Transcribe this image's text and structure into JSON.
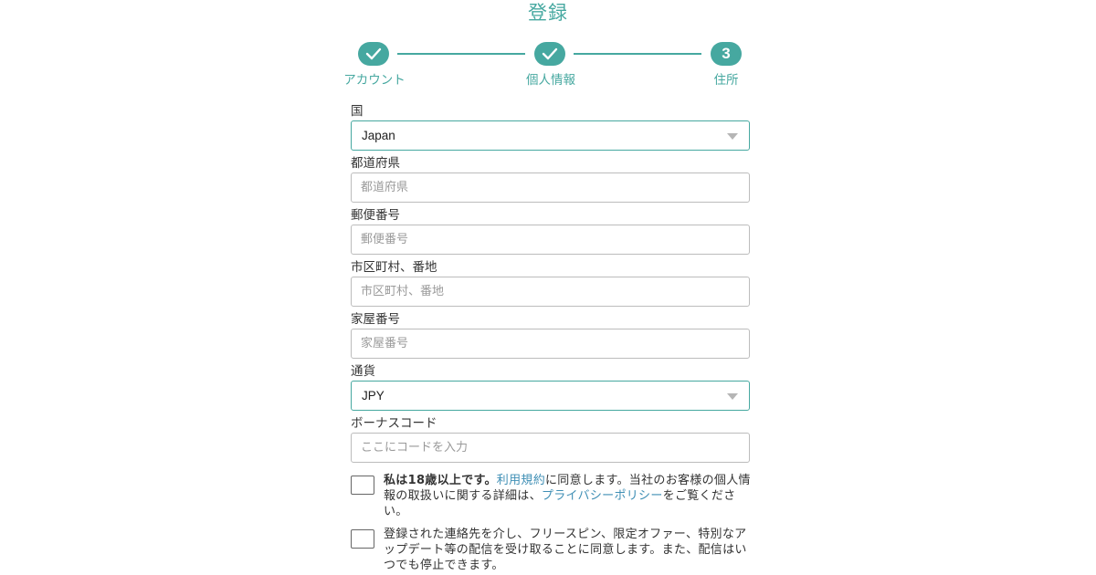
{
  "title": "登録",
  "colors": {
    "accent": "#46a8a0",
    "link": "#3f8fb5"
  },
  "steps": [
    {
      "label": "アカウント",
      "state": "done",
      "icon": "check-icon"
    },
    {
      "label": "個人情報",
      "state": "done",
      "icon": "check-icon"
    },
    {
      "label": "住所",
      "state": "current",
      "number": "3"
    }
  ],
  "form": {
    "country": {
      "label": "国",
      "value": "Japan"
    },
    "prefecture": {
      "label": "都道府県",
      "placeholder": "都道府県"
    },
    "postal": {
      "label": "郵便番号",
      "placeholder": "郵便番号"
    },
    "city": {
      "label": "市区町村、番地",
      "placeholder": "市区町村、番地"
    },
    "house": {
      "label": "家屋番号",
      "placeholder": "家屋番号"
    },
    "currency": {
      "label": "通貨",
      "value": "JPY"
    },
    "bonus": {
      "label": "ボーナスコード",
      "placeholder": "ここにコードを入力"
    }
  },
  "consent": {
    "age": {
      "bold": "私は18歳以上です。",
      "terms_link": "利用規約",
      "text1": "に同意します。当社のお客様の個人情報の取扱いに関する詳細は、",
      "privacy_link": "プライバシーポリシー",
      "text2": "をご覧ください。"
    },
    "marketing": {
      "text": "登録された連絡先を介し、フリースピン、限定オファー、特別なアップデート等の配信を受け取ることに同意します。また、配信はいつでも停止できます。"
    }
  }
}
